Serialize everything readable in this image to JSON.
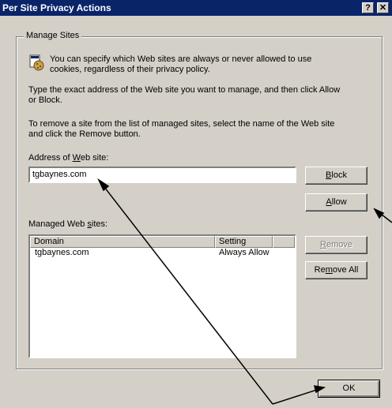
{
  "window": {
    "title": "Per Site Privacy Actions",
    "help_glyph": "?",
    "close_glyph": "✕"
  },
  "group": {
    "label": "Manage Sites"
  },
  "text": {
    "intro_line1": "You can specify which Web sites are always or never allowed to use",
    "intro_line2": "cookies, regardless of their privacy policy.",
    "type_line1": "Type the exact address of the Web site you want to manage, and then click Allow",
    "type_line2": "or Block.",
    "remove_line1": "To remove a site from the list of managed sites, select the name of the Web site",
    "remove_line2": "and click the Remove button."
  },
  "address": {
    "label_pre": "Address of ",
    "label_u": "W",
    "label_post": "eb site:",
    "value": "tgbaynes.com"
  },
  "buttons": {
    "block_u": "B",
    "block_rest": "lock",
    "allow_u": "A",
    "allow_rest": "llow",
    "remove_u": "R",
    "remove_rest": "emove",
    "removeall_pre": "Re",
    "removeall_u": "m",
    "removeall_post": "ove All",
    "ok": "OK"
  },
  "managed": {
    "label_pre": "Managed Web ",
    "label_u": "s",
    "label_post": "ites:"
  },
  "table": {
    "columns": [
      "Domain",
      "Setting"
    ],
    "rows": [
      {
        "domain": "tgbaynes.com",
        "setting": "Always Allow"
      }
    ]
  },
  "icon_name": "cookie-site-icon"
}
